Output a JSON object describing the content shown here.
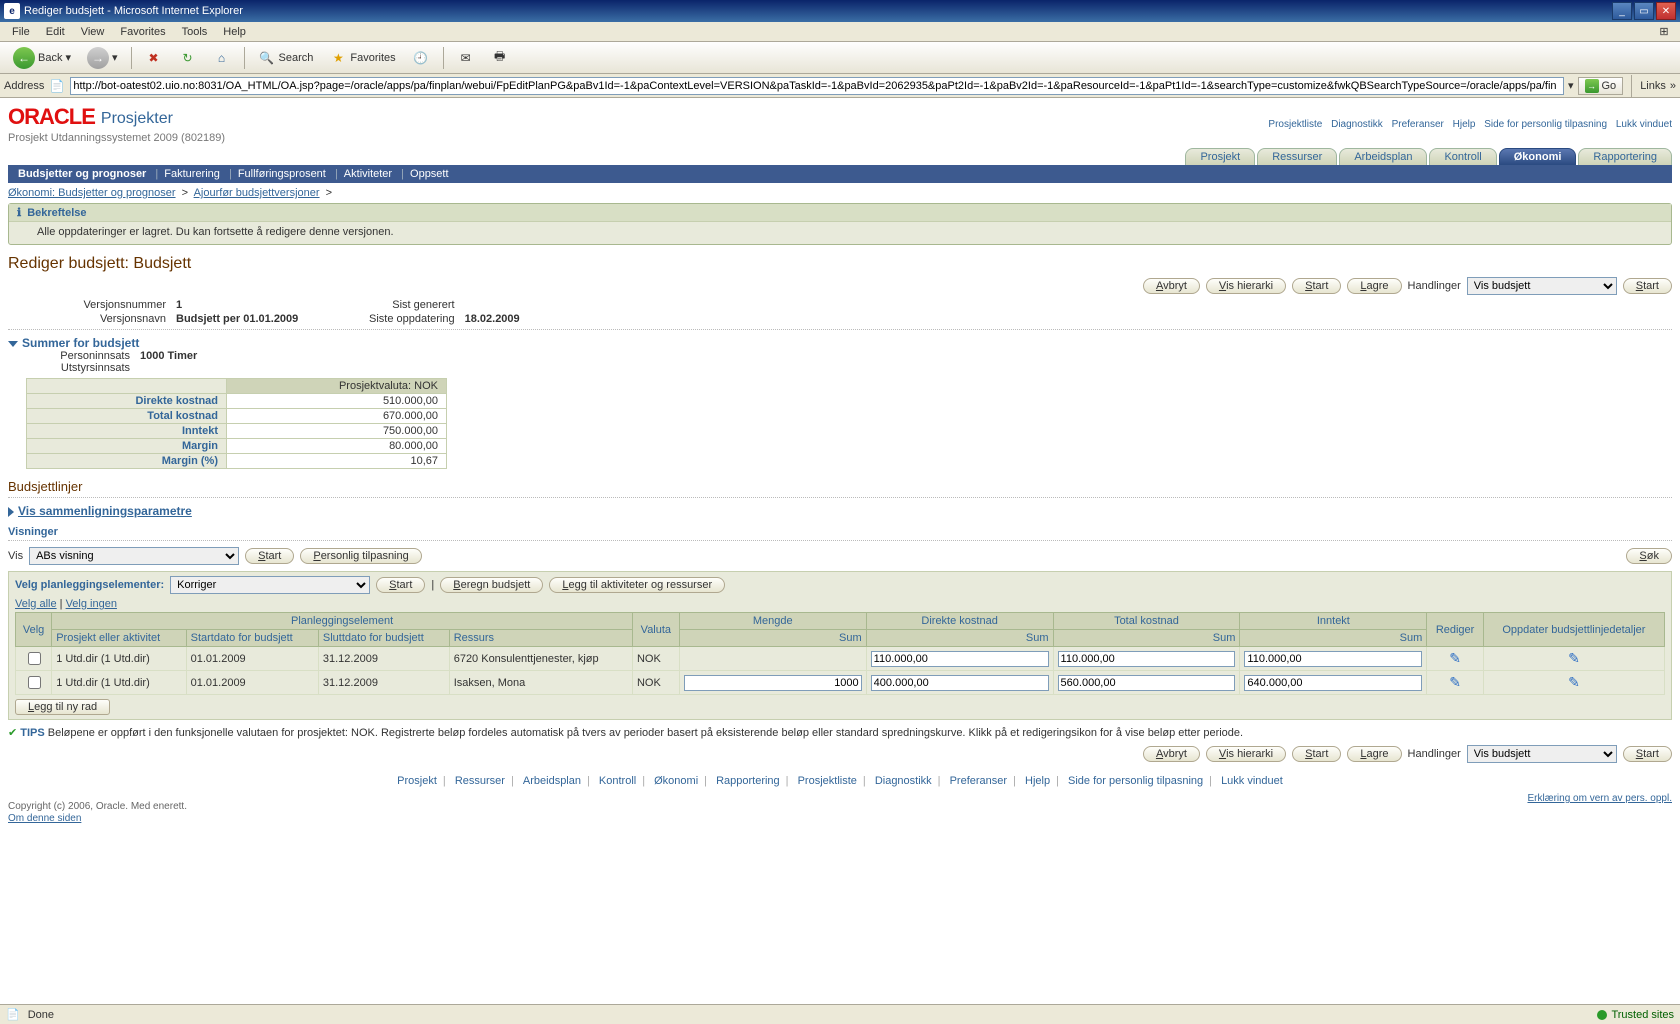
{
  "window": {
    "title": "Rediger budsjett - Microsoft Internet Explorer"
  },
  "ie": {
    "menu": [
      "File",
      "Edit",
      "View",
      "Favorites",
      "Tools",
      "Help"
    ],
    "back": "Back",
    "search": "Search",
    "favorites": "Favorites",
    "addr_label": "Address",
    "url": "http://bot-oatest02.uio.no:8031/OA_HTML/OA.jsp?page=/oracle/apps/pa/finplan/webui/FpEditPlanPG&paBv1Id=-1&paContextLevel=VERSION&paTaskId=-1&paBvId=2062935&paPt2Id=-1&paBv2Id=-1&paResourceId=-1&paPt1Id=-1&searchType=customize&fwkQBSearchTypeSource=/oracle/apps/pa/fin",
    "go": "Go",
    "links": "Links",
    "status_done": "Done",
    "status_trusted": "Trusted sites"
  },
  "header": {
    "logo": "ORACLE",
    "product": "Prosjekter",
    "project_context": "Prosjekt Utdanningssystemet 2009 (802189)",
    "nav_links": [
      "Prosjektliste",
      "Diagnostikk",
      "Preferanser",
      "Hjelp",
      "Side for personlig tilpasning",
      "Lukk vinduet"
    ]
  },
  "tabs": {
    "items": [
      "Prosjekt",
      "Ressurser",
      "Arbeidsplan",
      "Kontroll",
      "Økonomi",
      "Rapportering"
    ],
    "active": "Økonomi"
  },
  "subtabs": {
    "active": "Budsjetter og prognoser",
    "items": [
      "Fakturering",
      "Fullføringsprosent",
      "Aktiviteter",
      "Oppsett"
    ]
  },
  "breadcrumb": {
    "a": "Økonomi: Budsjetter og prognoser",
    "b": "Ajourfør budsjettversjoner"
  },
  "confirm": {
    "title": "Bekreftelse",
    "msg": "Alle oppdateringer er lagret. Du kan fortsette å redigere denne versjonen."
  },
  "page_title": "Rediger budsjett: Budsjett",
  "actions": {
    "avbryt": "Avbryt",
    "vis_hierarki": "Vis hierarki",
    "lagre": "Lagre",
    "start": "Start",
    "handlinger": "Handlinger",
    "handling_sel": "Vis budsjett"
  },
  "meta": {
    "versjonsnummer_lbl": "Versjonsnummer",
    "versjonsnummer": "1",
    "versjonsnavn_lbl": "Versjonsnavn",
    "versjonsnavn": "Budsjett per 01.01.2009",
    "sist_generert_lbl": "Sist generert",
    "sist_generert": "",
    "siste_oppdatering_lbl": "Siste oppdatering",
    "siste_oppdatering": "18.02.2009"
  },
  "sum": {
    "heading": "Summer for budsjett",
    "personinnsats_lbl": "Personinnsats",
    "personinnsats": "1000 Timer",
    "utstyrsinnsats_lbl": "Utstyrsinnsats",
    "currency_hdr": "Prosjektvaluta: NOK",
    "rows": [
      {
        "label": "Direkte kostnad",
        "value": "510.000,00"
      },
      {
        "label": "Total kostnad",
        "value": "670.000,00"
      },
      {
        "label": "Inntekt",
        "value": "750.000,00"
      },
      {
        "label": "Margin",
        "value": "80.000,00"
      },
      {
        "label": "Margin (%)",
        "value": "10,67"
      }
    ]
  },
  "lines": {
    "heading": "Budsjettlinjer",
    "vis_param": "Vis sammenligningsparametre",
    "visninger": "Visninger",
    "vis_lbl": "Vis",
    "vis_sel": "ABs visning",
    "personlig": "Personlig tilpasning",
    "sok": "Søk",
    "velg_plan_lbl": "Velg planleggingselementer:",
    "velg_plan_sel": "Korriger",
    "beregn": "Beregn budsjett",
    "legg_til_akt": "Legg til aktiviteter og ressurser",
    "velg_alle": "Velg alle",
    "velg_ingen": "Velg ingen",
    "legg_til_rad": "Legg til ny rad",
    "super_headers": {
      "plan": "Planleggingselement",
      "mengde": "Mengde",
      "direkte": "Direkte kostnad",
      "total": "Total kostnad",
      "inntekt": "Inntekt"
    },
    "sub_headers": {
      "velg": "Velg",
      "prosjekt": "Prosjekt eller aktivitet",
      "start": "Startdato for budsjett",
      "slutt": "Sluttdato for budsjett",
      "ressurs": "Ressurs",
      "valuta": "Valuta",
      "sum": "Sum",
      "rediger": "Rediger",
      "oppdater": "Oppdater budsjettlinjedetaljer"
    },
    "rows": [
      {
        "akt": "1 Utd.dir (1 Utd.dir)",
        "start": "01.01.2009",
        "slutt": "31.12.2009",
        "ressurs": "6720 Konsulenttjenester, kjøp",
        "valuta": "NOK",
        "mengde": "",
        "direkte": "110.000,00",
        "total": "110.000,00",
        "inntekt": "110.000,00"
      },
      {
        "akt": "1 Utd.dir (1 Utd.dir)",
        "start": "01.01.2009",
        "slutt": "31.12.2009",
        "ressurs": "Isaksen, Mona",
        "valuta": "NOK",
        "mengde": "1000",
        "direkte": "400.000,00",
        "total": "560.000,00",
        "inntekt": "640.000,00"
      }
    ]
  },
  "tips": {
    "label": "TIPS",
    "text": "Beløpene er oppført i den funksjonelle valutaen for prosjektet: NOK. Registrerte beløp fordeles automatisk på tvers av perioder basert på eksisterende beløp eller standard spredningskurve. Klikk på et redigeringsikon for å vise beløp etter periode."
  },
  "footer": {
    "links": [
      "Prosjekt",
      "Ressurser",
      "Arbeidsplan",
      "Kontroll",
      "Økonomi",
      "Rapportering",
      "Prosjektliste",
      "Diagnostikk",
      "Preferanser",
      "Hjelp",
      "Side for personlig tilpasning",
      "Lukk vinduet"
    ],
    "copyright": "Copyright (c) 2006, Oracle. Med enerett.",
    "about": "Om denne siden",
    "privacy": "Erklæring om vern av pers. oppl."
  }
}
